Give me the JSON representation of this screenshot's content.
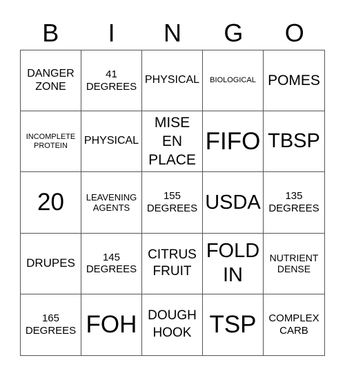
{
  "card": {
    "header": [
      "B",
      "I",
      "N",
      "G",
      "O"
    ],
    "rows": [
      [
        "DANGER\nZONE",
        "41\nDEGREES",
        "PHYSICAL",
        "BIOLOGICAL",
        "POMES"
      ],
      [
        "INCOMPLETE\nPROTEIN",
        "PHYSICAL",
        "MISE\nEN\nPLACE",
        "FIFO",
        "TBSP"
      ],
      [
        "20",
        "LEAVENING\nAGENTS",
        "155\nDEGREES",
        "USDA",
        "135\nDEGREES"
      ],
      [
        "DRUPES",
        "145\nDEGREES",
        "CITRUS\nFRUIT",
        "FOLD\nIN",
        "NUTRIENT\nDENSE"
      ],
      [
        "165\nDEGREES",
        "FOH",
        "DOUGH\nHOOK",
        "TSP",
        "COMPLEX\nCARB"
      ]
    ]
  }
}
